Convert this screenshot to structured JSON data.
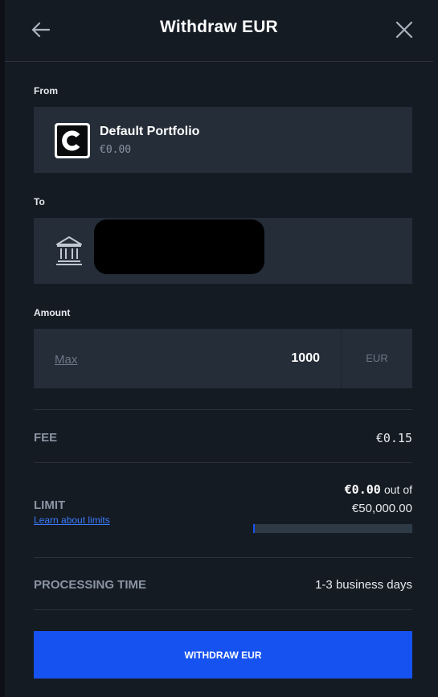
{
  "header": {
    "title": "Withdraw EUR",
    "back_icon": "arrow-left-icon",
    "close_icon": "close-icon"
  },
  "from": {
    "label": "From",
    "account_name": "Default Portfolio",
    "balance": "€0.00",
    "icon": "coinbase-logo"
  },
  "to": {
    "label": "To",
    "icon": "bank-icon"
  },
  "amount": {
    "label": "Amount",
    "max_label": "Max",
    "value": "1000",
    "currency": "EUR"
  },
  "fee": {
    "label": "FEE",
    "value": "€0.15"
  },
  "limit": {
    "label": "LIMIT",
    "link": "Learn about limits",
    "used": "€0.00",
    "out_of_text": "out of",
    "total": "€50,000.00",
    "used_fraction": 0.0
  },
  "processing": {
    "label": "PROCESSING TIME",
    "value": "1-3 business days"
  },
  "submit": {
    "label": "WITHDRAW EUR"
  },
  "colors": {
    "background": "#151b23",
    "field": "#242d38",
    "accent": "#1652f0",
    "link": "#3b7bff"
  }
}
